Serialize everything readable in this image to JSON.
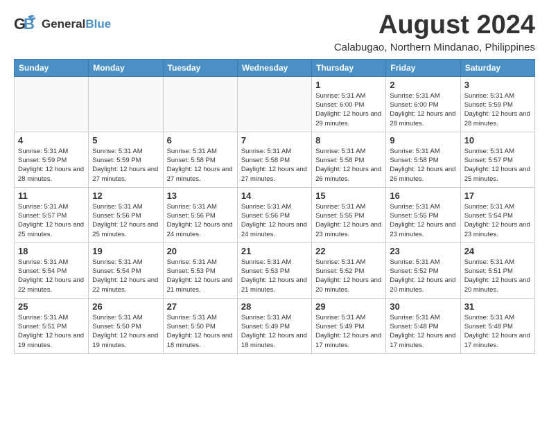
{
  "logo": {
    "general": "General",
    "blue": "Blue"
  },
  "title": {
    "month_year": "August 2024",
    "location": "Calabugao, Northern Mindanao, Philippines"
  },
  "days_of_week": [
    "Sunday",
    "Monday",
    "Tuesday",
    "Wednesday",
    "Thursday",
    "Friday",
    "Saturday"
  ],
  "weeks": [
    [
      {
        "num": "",
        "info": ""
      },
      {
        "num": "",
        "info": ""
      },
      {
        "num": "",
        "info": ""
      },
      {
        "num": "",
        "info": ""
      },
      {
        "num": "1",
        "info": "Sunrise: 5:31 AM\nSunset: 6:00 PM\nDaylight: 12 hours and 29 minutes."
      },
      {
        "num": "2",
        "info": "Sunrise: 5:31 AM\nSunset: 6:00 PM\nDaylight: 12 hours and 28 minutes."
      },
      {
        "num": "3",
        "info": "Sunrise: 5:31 AM\nSunset: 5:59 PM\nDaylight: 12 hours and 28 minutes."
      }
    ],
    [
      {
        "num": "4",
        "info": "Sunrise: 5:31 AM\nSunset: 5:59 PM\nDaylight: 12 hours and 28 minutes."
      },
      {
        "num": "5",
        "info": "Sunrise: 5:31 AM\nSunset: 5:59 PM\nDaylight: 12 hours and 27 minutes."
      },
      {
        "num": "6",
        "info": "Sunrise: 5:31 AM\nSunset: 5:58 PM\nDaylight: 12 hours and 27 minutes."
      },
      {
        "num": "7",
        "info": "Sunrise: 5:31 AM\nSunset: 5:58 PM\nDaylight: 12 hours and 27 minutes."
      },
      {
        "num": "8",
        "info": "Sunrise: 5:31 AM\nSunset: 5:58 PM\nDaylight: 12 hours and 26 minutes."
      },
      {
        "num": "9",
        "info": "Sunrise: 5:31 AM\nSunset: 5:58 PM\nDaylight: 12 hours and 26 minutes."
      },
      {
        "num": "10",
        "info": "Sunrise: 5:31 AM\nSunset: 5:57 PM\nDaylight: 12 hours and 25 minutes."
      }
    ],
    [
      {
        "num": "11",
        "info": "Sunrise: 5:31 AM\nSunset: 5:57 PM\nDaylight: 12 hours and 25 minutes."
      },
      {
        "num": "12",
        "info": "Sunrise: 5:31 AM\nSunset: 5:56 PM\nDaylight: 12 hours and 25 minutes."
      },
      {
        "num": "13",
        "info": "Sunrise: 5:31 AM\nSunset: 5:56 PM\nDaylight: 12 hours and 24 minutes."
      },
      {
        "num": "14",
        "info": "Sunrise: 5:31 AM\nSunset: 5:56 PM\nDaylight: 12 hours and 24 minutes."
      },
      {
        "num": "15",
        "info": "Sunrise: 5:31 AM\nSunset: 5:55 PM\nDaylight: 12 hours and 23 minutes."
      },
      {
        "num": "16",
        "info": "Sunrise: 5:31 AM\nSunset: 5:55 PM\nDaylight: 12 hours and 23 minutes."
      },
      {
        "num": "17",
        "info": "Sunrise: 5:31 AM\nSunset: 5:54 PM\nDaylight: 12 hours and 23 minutes."
      }
    ],
    [
      {
        "num": "18",
        "info": "Sunrise: 5:31 AM\nSunset: 5:54 PM\nDaylight: 12 hours and 22 minutes."
      },
      {
        "num": "19",
        "info": "Sunrise: 5:31 AM\nSunset: 5:54 PM\nDaylight: 12 hours and 22 minutes."
      },
      {
        "num": "20",
        "info": "Sunrise: 5:31 AM\nSunset: 5:53 PM\nDaylight: 12 hours and 21 minutes."
      },
      {
        "num": "21",
        "info": "Sunrise: 5:31 AM\nSunset: 5:53 PM\nDaylight: 12 hours and 21 minutes."
      },
      {
        "num": "22",
        "info": "Sunrise: 5:31 AM\nSunset: 5:52 PM\nDaylight: 12 hours and 20 minutes."
      },
      {
        "num": "23",
        "info": "Sunrise: 5:31 AM\nSunset: 5:52 PM\nDaylight: 12 hours and 20 minutes."
      },
      {
        "num": "24",
        "info": "Sunrise: 5:31 AM\nSunset: 5:51 PM\nDaylight: 12 hours and 20 minutes."
      }
    ],
    [
      {
        "num": "25",
        "info": "Sunrise: 5:31 AM\nSunset: 5:51 PM\nDaylight: 12 hours and 19 minutes."
      },
      {
        "num": "26",
        "info": "Sunrise: 5:31 AM\nSunset: 5:50 PM\nDaylight: 12 hours and 19 minutes."
      },
      {
        "num": "27",
        "info": "Sunrise: 5:31 AM\nSunset: 5:50 PM\nDaylight: 12 hours and 18 minutes."
      },
      {
        "num": "28",
        "info": "Sunrise: 5:31 AM\nSunset: 5:49 PM\nDaylight: 12 hours and 18 minutes."
      },
      {
        "num": "29",
        "info": "Sunrise: 5:31 AM\nSunset: 5:49 PM\nDaylight: 12 hours and 17 minutes."
      },
      {
        "num": "30",
        "info": "Sunrise: 5:31 AM\nSunset: 5:48 PM\nDaylight: 12 hours and 17 minutes."
      },
      {
        "num": "31",
        "info": "Sunrise: 5:31 AM\nSunset: 5:48 PM\nDaylight: 12 hours and 17 minutes."
      }
    ]
  ]
}
